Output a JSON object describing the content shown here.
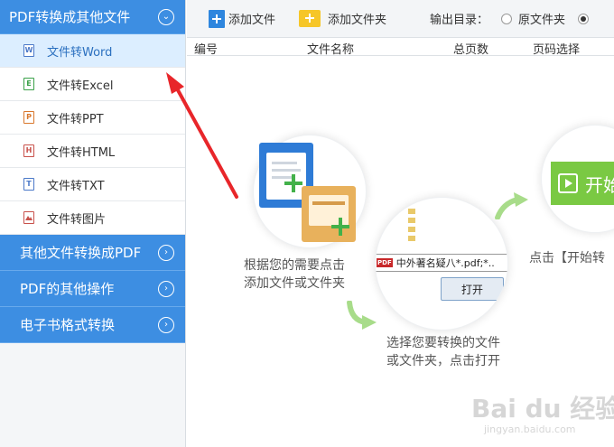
{
  "sidebar": {
    "open_category": "PDF转换成其他文件",
    "items": [
      {
        "label": "文件转Word",
        "icon": "word-file-icon",
        "letter": "W"
      },
      {
        "label": "文件转Excel",
        "icon": "excel-file-icon",
        "letter": "E"
      },
      {
        "label": "文件转PPT",
        "icon": "ppt-file-icon",
        "letter": "P"
      },
      {
        "label": "文件转HTML",
        "icon": "html-file-icon",
        "letter": "H"
      },
      {
        "label": "文件转TXT",
        "icon": "txt-file-icon",
        "letter": "T"
      },
      {
        "label": "文件转图片",
        "icon": "image-file-icon",
        "letter": ""
      }
    ],
    "collapsed": [
      "其他文件转换成PDF",
      "PDF的其他操作",
      "电子书格式转换"
    ]
  },
  "toolbar": {
    "add_file": "添加文件",
    "add_folder": "添加文件夹",
    "output_dir_label": "输出目录：",
    "radio_original": "原文件夹"
  },
  "table": {
    "headers": [
      "编号",
      "文件名称",
      "总页数",
      "页码选择"
    ]
  },
  "guide": {
    "step1_caption": "根据您的需要点击\n添加文件或文件夹",
    "step2_caption": "选择您要转换的文件\n或文件夹，点击打开",
    "step3_caption": "点击【开始转",
    "dialog_folder_rows": [
      "",
      "",
      "",
      ""
    ],
    "dialog_filename": "中外著名疑",
    "dialog_filter": "八*.pdf;*..",
    "dialog_open": "打开",
    "start_button": "开始"
  },
  "watermark": {
    "main": "Bai du 经验",
    "sub": "jingyan.baidu.com"
  },
  "colors": {
    "accent_blue": "#3d8ee2",
    "active_item_bg": "#dceeff",
    "green": "#7ac943",
    "annotation_red": "#e8262a"
  }
}
